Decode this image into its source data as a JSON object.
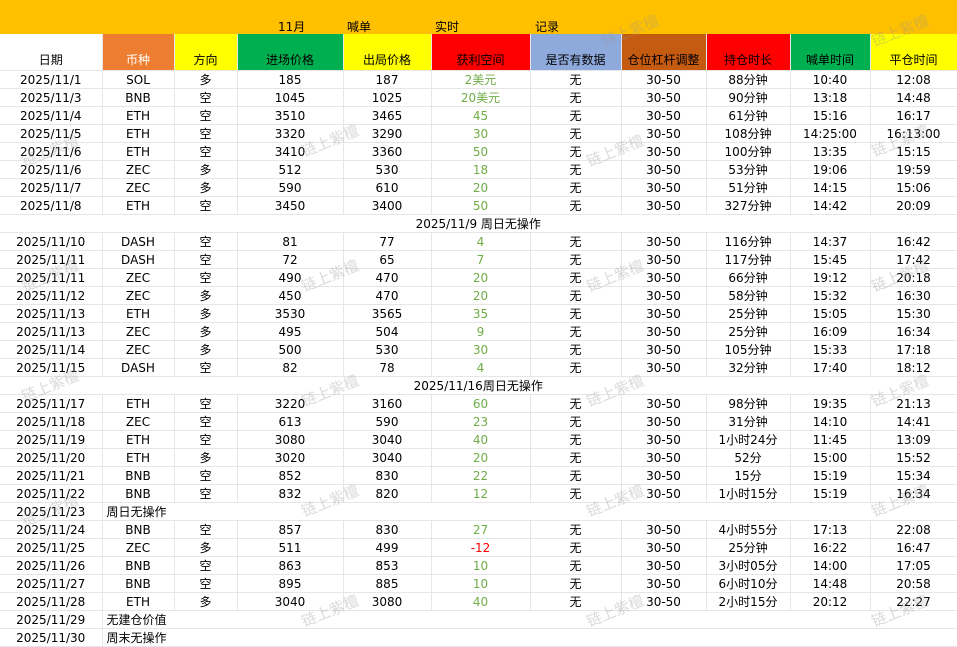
{
  "title_row": {
    "month": "11月",
    "call": "喊单",
    "realtime": "实时",
    "record": "记录"
  },
  "headers": {
    "date": "日期",
    "coin": "币种",
    "direction": "方向",
    "entry": "进场价格",
    "exit": "出局价格",
    "profit": "获利空间",
    "has_data": "是否有数据",
    "leverage": "仓位杠杆调整",
    "hold": "持仓时长",
    "call_time": "喊单时间",
    "close_time": "平仓时间"
  },
  "watermark": "链上紫檀",
  "colors": {
    "title_bar": "#FFC000",
    "coin": "#ED7D31",
    "direction": "#FFFF00",
    "entry": "#00B050",
    "exit": "#FFFF00",
    "profit": "#FF0000",
    "has_data": "#8EA9DB",
    "leverage": "#C55A11",
    "hold": "#FF0000",
    "call_time": "#00B050",
    "close_time": "#FFFF00",
    "profit_text": "#70AD47",
    "loss_text": "#FF0000"
  },
  "rows": [
    {
      "type": "trade",
      "date": "2025/11/1",
      "coin": "SOL",
      "dir": "多",
      "entry": "185",
      "exit": "187",
      "profit": "2美元",
      "data": "无",
      "lev": "30-50",
      "hold": "88分钟",
      "call": "10:40",
      "close": "12:08"
    },
    {
      "type": "trade",
      "date": "2025/11/3",
      "coin": "BNB",
      "dir": "空",
      "entry": "1045",
      "exit": "1025",
      "profit": "20美元",
      "data": "无",
      "lev": "30-50",
      "hold": "90分钟",
      "call": "13:18",
      "close": "14:48"
    },
    {
      "type": "trade",
      "date": "2025/11/4",
      "coin": "ETH",
      "dir": "空",
      "entry": "3510",
      "exit": "3465",
      "profit": "45",
      "data": "无",
      "lev": "30-50",
      "hold": "61分钟",
      "call": "15:16",
      "close": "16:17"
    },
    {
      "type": "trade",
      "date": "2025/11/5",
      "coin": "ETH",
      "dir": "空",
      "entry": "3320",
      "exit": "3290",
      "profit": "30",
      "data": "无",
      "lev": "30-50",
      "hold": "108分钟",
      "call": "14:25:00",
      "close": "16:13:00"
    },
    {
      "type": "trade",
      "date": "2025/11/6",
      "coin": "ETH",
      "dir": "空",
      "entry": "3410",
      "exit": "3360",
      "profit": "50",
      "data": "无",
      "lev": "30-50",
      "hold": "100分钟",
      "call": "13:35",
      "close": "15:15"
    },
    {
      "type": "trade",
      "date": "2025/11/6",
      "coin": "ZEC",
      "dir": "多",
      "entry": "512",
      "exit": "530",
      "profit": "18",
      "data": "无",
      "lev": "30-50",
      "hold": "53分钟",
      "call": "19:06",
      "close": "19:59"
    },
    {
      "type": "trade",
      "date": "2025/11/7",
      "coin": "ZEC",
      "dir": "多",
      "entry": "590",
      "exit": "610",
      "profit": "20",
      "data": "无",
      "lev": "30-50",
      "hold": "51分钟",
      "call": "14:15",
      "close": "15:06"
    },
    {
      "type": "trade",
      "date": "2025/11/8",
      "coin": "ETH",
      "dir": "空",
      "entry": "3450",
      "exit": "3400",
      "profit": "50",
      "data": "无",
      "lev": "30-50",
      "hold": "327分钟",
      "call": "14:42",
      "close": "20:09"
    },
    {
      "type": "note",
      "text": "2025/11/9  周日无操作"
    },
    {
      "type": "trade",
      "date": "2025/11/10",
      "coin": "DASH",
      "dir": "空",
      "entry": "81",
      "exit": "77",
      "profit": "4",
      "data": "无",
      "lev": "30-50",
      "hold": "116分钟",
      "call": "14:37",
      "close": "16:42"
    },
    {
      "type": "trade",
      "date": "2025/11/11",
      "coin": "DASH",
      "dir": "空",
      "entry": "72",
      "exit": "65",
      "profit": "7",
      "data": "无",
      "lev": "30-50",
      "hold": "117分钟",
      "call": "15:45",
      "close": "17:42"
    },
    {
      "type": "trade",
      "date": "2025/11/11",
      "coin": "ZEC",
      "dir": "空",
      "entry": "490",
      "exit": "470",
      "profit": "20",
      "data": "无",
      "lev": "30-50",
      "hold": "66分钟",
      "call": "19:12",
      "close": "20:18"
    },
    {
      "type": "trade",
      "date": "2025/11/12",
      "coin": "ZEC",
      "dir": "多",
      "entry": "450",
      "exit": "470",
      "profit": "20",
      "data": "无",
      "lev": "30-50",
      "hold": "58分钟",
      "call": "15:32",
      "close": "16:30"
    },
    {
      "type": "trade",
      "date": "2025/11/13",
      "coin": "ETH",
      "dir": "多",
      "entry": "3530",
      "exit": "3565",
      "profit": "35",
      "data": "无",
      "lev": "30-50",
      "hold": "25分钟",
      "call": "15:05",
      "close": "15:30"
    },
    {
      "type": "trade",
      "date": "2025/11/13",
      "coin": "ZEC",
      "dir": "多",
      "entry": "495",
      "exit": "504",
      "profit": "9",
      "data": "无",
      "lev": "30-50",
      "hold": "25分钟",
      "call": "16:09",
      "close": "16:34"
    },
    {
      "type": "trade",
      "date": "2025/11/14",
      "coin": "ZEC",
      "dir": "多",
      "entry": "500",
      "exit": "530",
      "profit": "30",
      "data": "无",
      "lev": "30-50",
      "hold": "105分钟",
      "call": "15:33",
      "close": "17:18"
    },
    {
      "type": "trade",
      "date": "2025/11/15",
      "coin": "DASH",
      "dir": "空",
      "entry": "82",
      "exit": "78",
      "profit": "4",
      "data": "无",
      "lev": "30-50",
      "hold": "32分钟",
      "call": "17:40",
      "close": "18:12"
    },
    {
      "type": "note",
      "text": "2025/11/16周日无操作"
    },
    {
      "type": "trade",
      "date": "2025/11/17",
      "coin": "ETH",
      "dir": "空",
      "entry": "3220",
      "exit": "3160",
      "profit": "60",
      "data": "无",
      "lev": "30-50",
      "hold": "98分钟",
      "call": "19:35",
      "close": "21:13"
    },
    {
      "type": "trade",
      "date": "2025/11/18",
      "coin": "ZEC",
      "dir": "空",
      "entry": "613",
      "exit": "590",
      "profit": "23",
      "data": "无",
      "lev": "30-50",
      "hold": "31分钟",
      "call": "14:10",
      "close": "14:41"
    },
    {
      "type": "trade",
      "date": "2025/11/19",
      "coin": "ETH",
      "dir": "空",
      "entry": "3080",
      "exit": "3040",
      "profit": "40",
      "data": "无",
      "lev": "30-50",
      "hold": "1小时24分",
      "call": "11:45",
      "close": "13:09"
    },
    {
      "type": "trade",
      "date": "2025/11/20",
      "coin": "ETH",
      "dir": "多",
      "entry": "3020",
      "exit": "3040",
      "profit": "20",
      "data": "无",
      "lev": "30-50",
      "hold": "52分",
      "call": "15:00",
      "close": "15:52"
    },
    {
      "type": "trade",
      "date": "2025/11/21",
      "coin": "BNB",
      "dir": "空",
      "entry": "852",
      "exit": "830",
      "profit": "22",
      "data": "无",
      "lev": "30-50",
      "hold": "15分",
      "call": "15:19",
      "close": "15:34"
    },
    {
      "type": "trade",
      "date": "2025/11/22",
      "coin": "BNB",
      "dir": "空",
      "entry": "832",
      "exit": "820",
      "profit": "12",
      "data": "无",
      "lev": "30-50",
      "hold": "1小时15分",
      "call": "15:19",
      "close": "16:34"
    },
    {
      "type": "dnote",
      "date": "2025/11/23",
      "text": "周日无操作"
    },
    {
      "type": "trade",
      "date": "2025/11/24",
      "coin": "BNB",
      "dir": "空",
      "entry": "857",
      "exit": "830",
      "profit": "27",
      "data": "无",
      "lev": "30-50",
      "hold": "4小时55分",
      "call": "17:13",
      "close": "22:08"
    },
    {
      "type": "trade",
      "date": "2025/11/25",
      "coin": "ZEC",
      "dir": "多",
      "entry": "511",
      "exit": "499",
      "profit": "-12",
      "data": "无",
      "lev": "30-50",
      "hold": "25分钟",
      "call": "16:22",
      "close": "16:47"
    },
    {
      "type": "trade",
      "date": "2025/11/26",
      "coin": "BNB",
      "dir": "空",
      "entry": "863",
      "exit": "853",
      "profit": "10",
      "data": "无",
      "lev": "30-50",
      "hold": "3小时05分",
      "call": "14:00",
      "close": "17:05"
    },
    {
      "type": "trade",
      "date": "2025/11/27",
      "coin": "BNB",
      "dir": "空",
      "entry": "895",
      "exit": "885",
      "profit": "10",
      "data": "无",
      "lev": "30-50",
      "hold": "6小时10分",
      "call": "14:48",
      "close": "20:58"
    },
    {
      "type": "trade",
      "date": "2025/11/28",
      "coin": "ETH",
      "dir": "多",
      "entry": "3040",
      "exit": "3080",
      "profit": "40",
      "data": "无",
      "lev": "30-50",
      "hold": "2小时15分",
      "call": "20:12",
      "close": "22:27"
    },
    {
      "type": "dnote",
      "date": "2025/11/29",
      "text": "无建仓价值"
    },
    {
      "type": "dnote",
      "date": "2025/11/30",
      "text": "周末无操作"
    }
  ]
}
